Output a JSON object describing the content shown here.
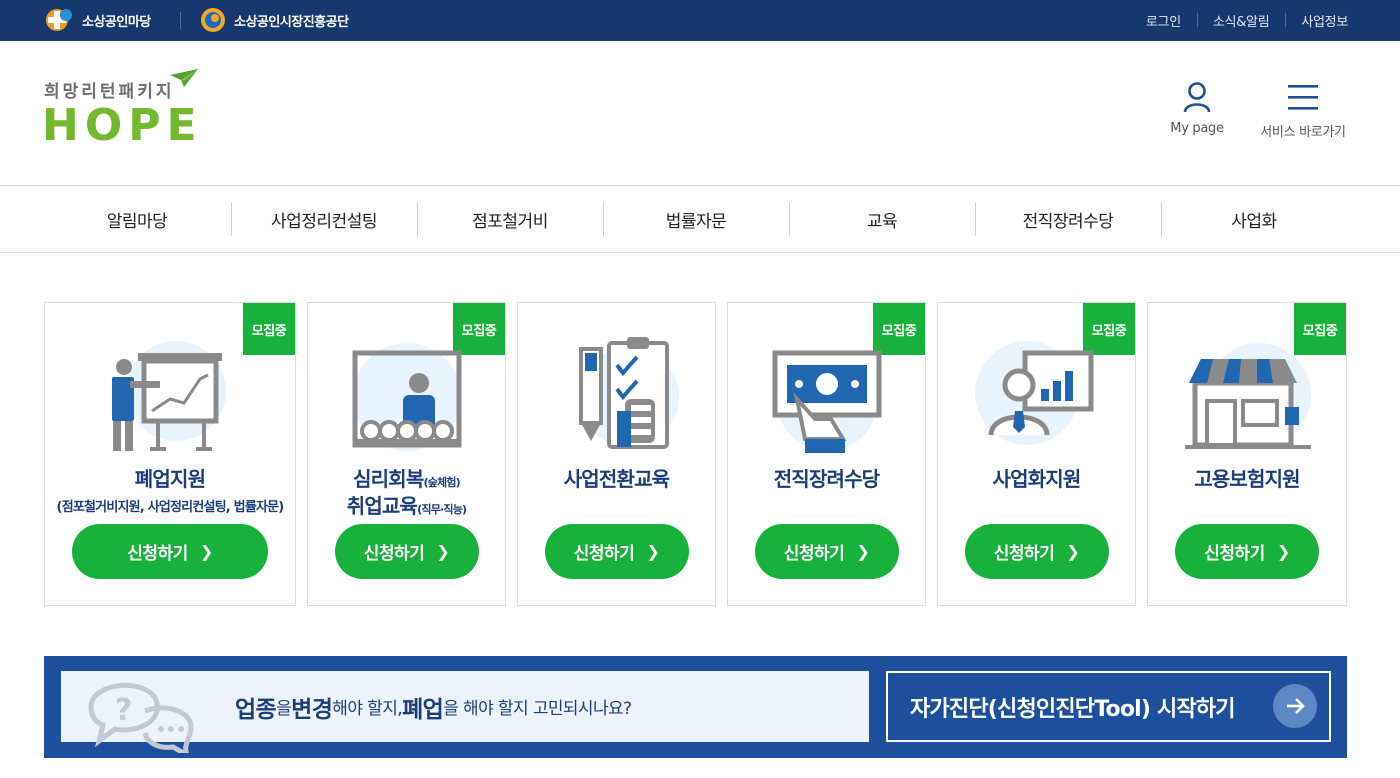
{
  "topbar": {
    "logo1_text": "소상공인마당",
    "logo2_text": "소상공인시장진흥공단",
    "links": [
      "로그인",
      "소식&알림",
      "사업정보"
    ]
  },
  "header": {
    "brand_sub": "희망리턴패키지",
    "brand_main": "HOPE",
    "mypage_label": "My page",
    "service_label": "서비스 바로가기"
  },
  "nav": {
    "items": [
      "알림마당",
      "사업정리컨설팅",
      "점포철거비",
      "법률자문",
      "교육",
      "전직장려수당",
      "사업화"
    ]
  },
  "cards": [
    {
      "badge": "모집중",
      "title": "폐업지원",
      "sub": "(점포철거비지원, 사업정리컨설팅, 법률자문)",
      "button": "신청하기",
      "icon": "presentation-icon"
    },
    {
      "badge": "모집중",
      "title": "심리회복",
      "title_small": "(숲체험)",
      "title2": "취업교육",
      "title2_small": "(직무·직능)",
      "button": "신청하기",
      "icon": "classroom-icon"
    },
    {
      "badge": "",
      "title": "사업전환교육",
      "button": "신청하기",
      "icon": "checklist-icon"
    },
    {
      "badge": "모집중",
      "title": "전직장려수당",
      "button": "신청하기",
      "icon": "money-hand-icon"
    },
    {
      "badge": "모집중",
      "title": "사업화지원",
      "button": "신청하기",
      "icon": "businessman-chart-icon"
    },
    {
      "badge": "모집중",
      "title": "고용보험지원",
      "button": "신청하기",
      "icon": "storefront-icon"
    }
  ],
  "banner": {
    "text_part1": "업종",
    "text_part2": "을 ",
    "text_part3": "변경",
    "text_part4": "해야 할지, ",
    "text_part5": "폐업",
    "text_part6": "을 해야 할지 고민되시나요?",
    "cta_label": "자가진단(신청인진단Tool) 시작하기"
  },
  "colors": {
    "topbar": "#17386f",
    "accent_green": "#18b13b",
    "brand_green": "#74b82e",
    "title_navy": "#1c3d7a",
    "banner_blue": "#1d4f9c"
  }
}
